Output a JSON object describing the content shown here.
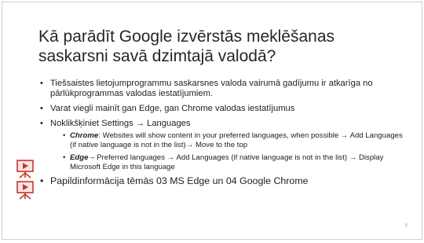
{
  "slide": {
    "title": "Kā parādīt Google izvērstās meklēšanas saskarsni savā dzimtajā valodā?",
    "bullets": [
      "Tiešsaistes lietojumprogrammu saskarsnes valoda vairumā gadījumu ir atkarīga no pārlūkprogrammas valodas iestatījumiem.",
      "Varat viegli mainīt gan Edge, gan Chrome valodas iestatījumus",
      "Noklikšķiniet Settings → Languages"
    ],
    "sub_bullets": [
      {
        "keyword": "Chrome",
        "text": ": Websites will show content in your preferred languages, when possible → Add Languages (if native language is not in the list)→ Move to the top"
      },
      {
        "keyword": "Edge",
        "text": " – Preferred languages → Add Languages (if native language is not in the list) → Display Microsoft Edge in this language"
      }
    ],
    "final_bullet": "Papildinformācija tēmās 03 MS Edge un 04 Google Chrome",
    "bullet_char": "•",
    "page_number": "6",
    "icons": [
      "video-presentation-icon",
      "video-presentation-icon"
    ],
    "colors": {
      "icon_red": "#c0392b",
      "icon_fill": "#fbe3e3",
      "title": "#262626"
    }
  }
}
